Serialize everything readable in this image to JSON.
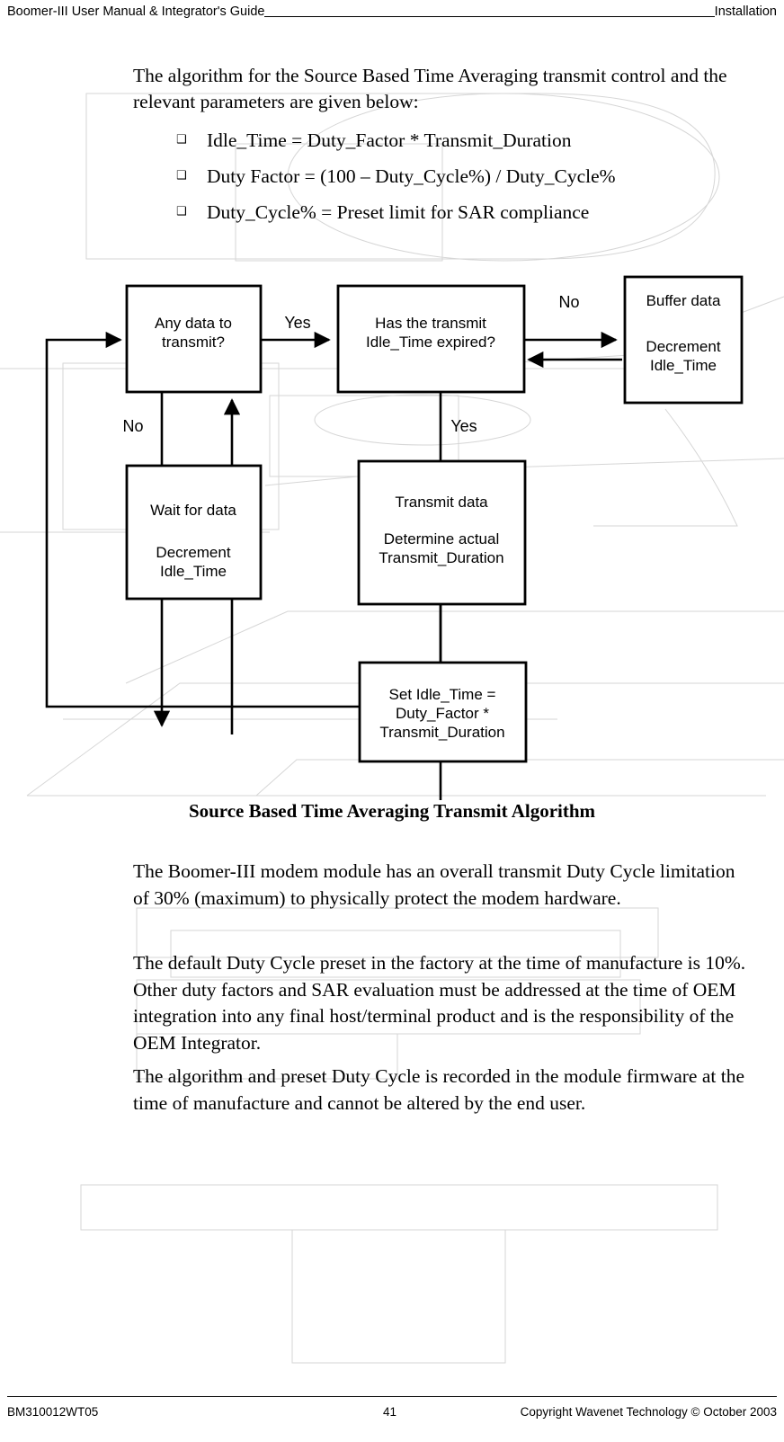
{
  "header": {
    "left": "Boomer-III User Manual & Integrator's Guide",
    "right": "Installation"
  },
  "intro": {
    "text": "The algorithm for the Source Based Time Averaging transmit control and the relevant parameters are given below:"
  },
  "bullets": {
    "marker": "❑",
    "items": [
      "Idle_Time = Duty_Factor * Transmit_Duration",
      "Duty Factor = (100 – Duty_Cycle%) / Duty_Cycle%",
      "Duty_Cycle% = Preset limit for SAR compliance"
    ]
  },
  "figure": {
    "caption": "Source Based Time Averaging Transmit Algorithm",
    "nodes": {
      "any_data": {
        "line1": "Any data to",
        "line2": "transmit?"
      },
      "idle_expired": {
        "line1": "Has the transmit",
        "line2": "Idle_Time expired?"
      },
      "buffer": {
        "line1": "Buffer data",
        "line2": "Decrement",
        "line3": "Idle_Time"
      },
      "wait": {
        "line1": "Wait for data",
        "line2": "Decrement",
        "line3": "Idle_Time"
      },
      "transmit": {
        "line1": "Transmit data",
        "line2": "Determine actual",
        "line3": "Transmit_Duration"
      },
      "set_idle": {
        "line1": "Set Idle_Time =",
        "line2": "Duty_Factor *",
        "line3": "Transmit_Duration"
      }
    },
    "edges": {
      "any_to_idle": "Yes",
      "any_to_wait": "No",
      "idle_to_buffer": "No",
      "idle_to_transmit": "Yes"
    }
  },
  "paragraphs": {
    "p1": "The Boomer-III modem module has an overall transmit Duty Cycle limitation of 30% (maximum) to physically protect the modem hardware.",
    "p2": "The default Duty Cycle preset in the factory at the time of manufacture is 10%.  Other duty factors and SAR evaluation must be addressed at the time of OEM integration into any final host/terminal product and is the responsibility of the OEM Integrator.",
    "p3": "The algorithm and preset Duty Cycle is recorded in the module firmware at the time of manufacture and cannot be altered by the end user."
  },
  "footer": {
    "doc_id": "BM310012WT05",
    "page_number": "41",
    "copyright": "Copyright Wavenet Technology © October 2003"
  }
}
